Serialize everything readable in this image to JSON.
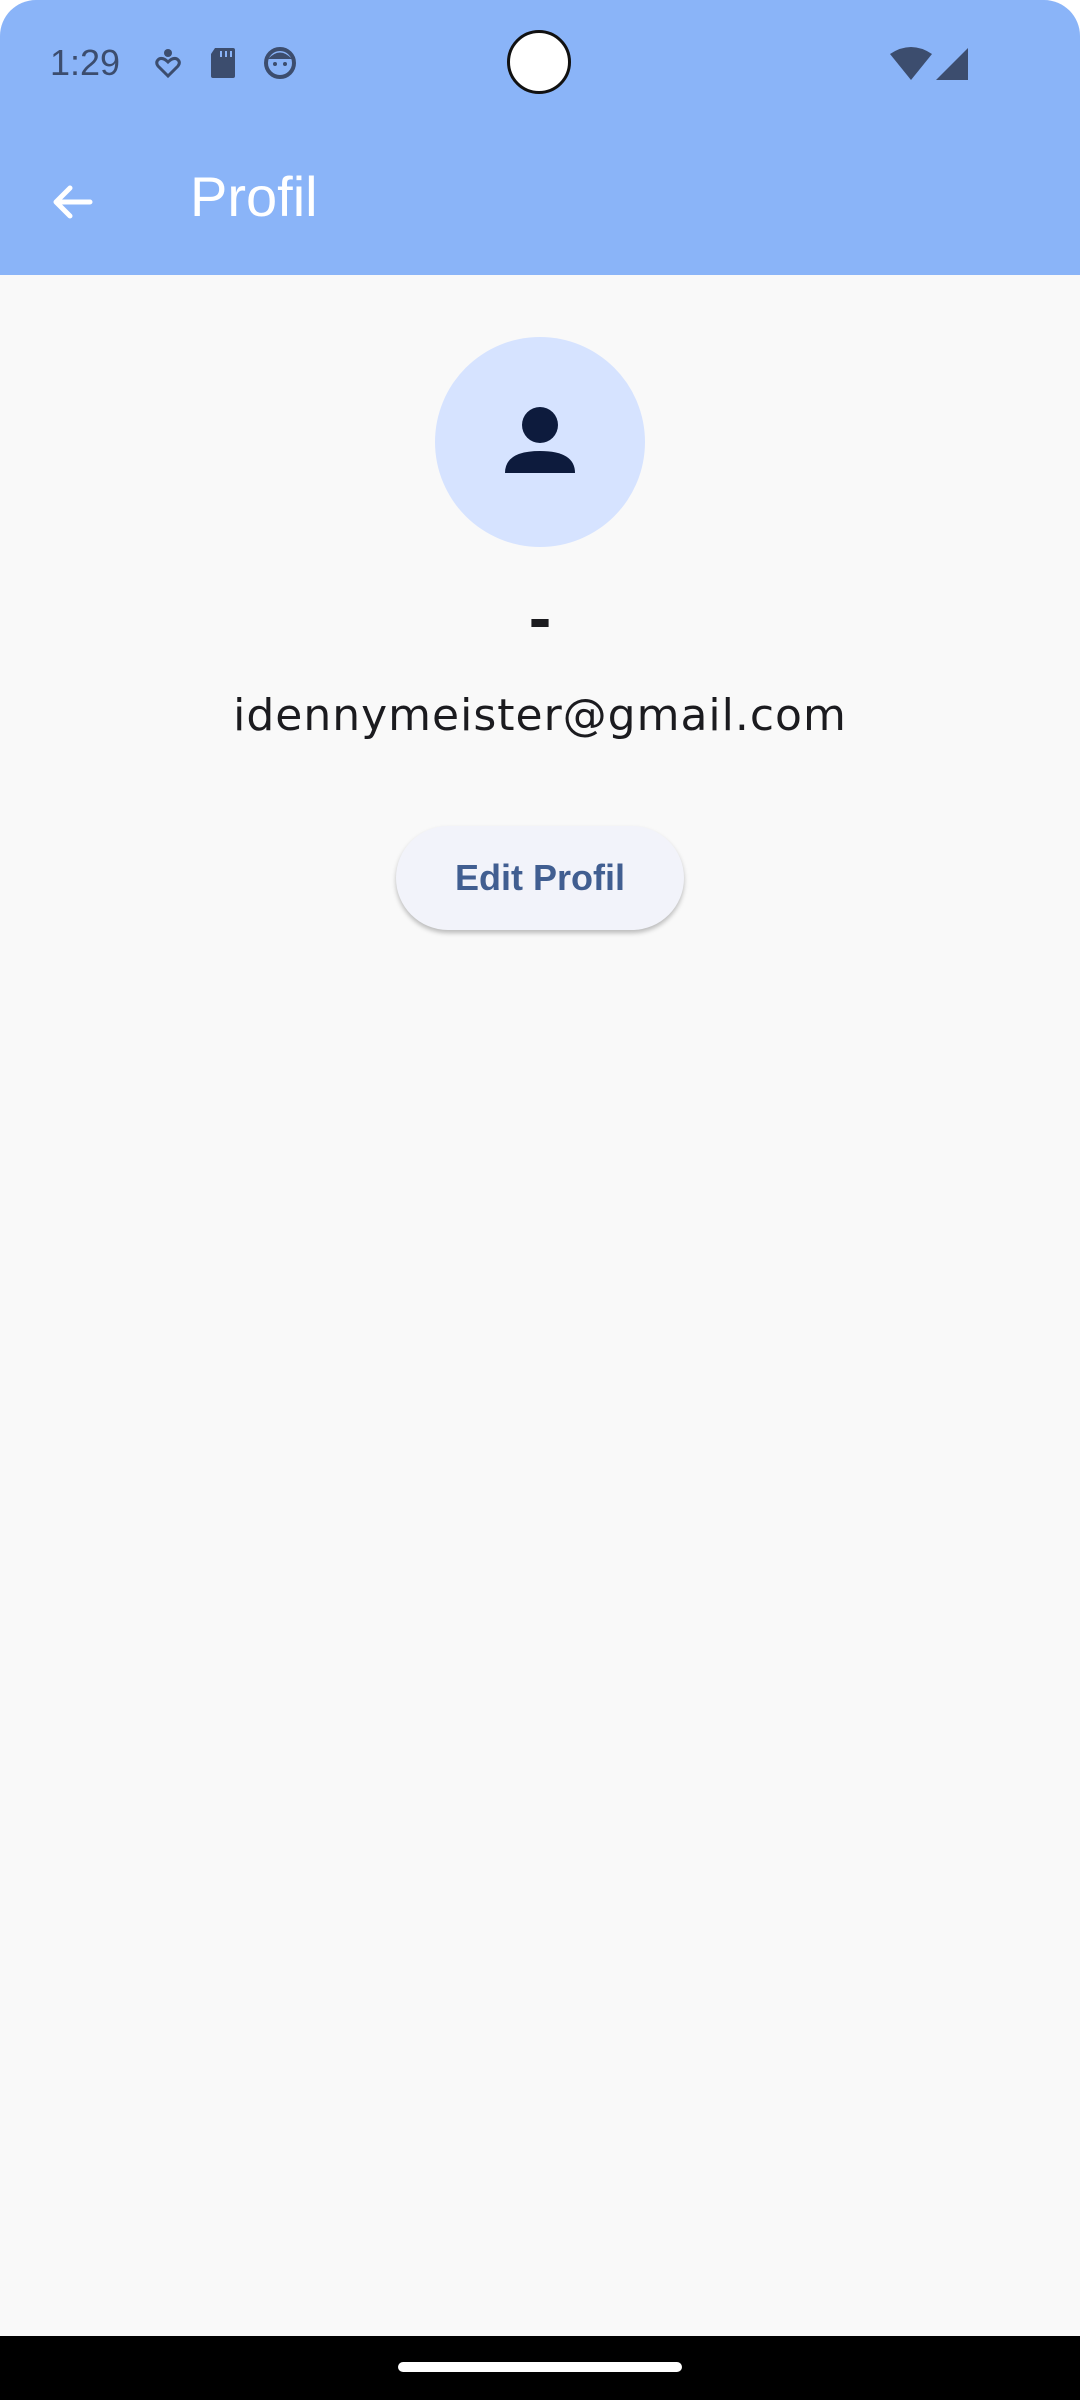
{
  "status_bar": {
    "time": "1:29",
    "icons": [
      "location-heart-icon",
      "sd-card-icon",
      "face-icon"
    ],
    "right_icons": [
      "wifi-icon",
      "cellular-signal-icon"
    ]
  },
  "app_bar": {
    "back_icon": "arrow-back-icon",
    "title": "Profil"
  },
  "profile": {
    "avatar_icon": "person-icon",
    "name": "-",
    "email": "idennymeister@gmail.com",
    "edit_button_label": "Edit Profil"
  },
  "colors": {
    "header": "#8ab4f8",
    "background": "#f9f9f9",
    "avatar_bg": "#d6e3ff",
    "avatar_icon": "#0d1b3d",
    "button_text": "#415e91",
    "button_bg": "#f2f3fa"
  }
}
